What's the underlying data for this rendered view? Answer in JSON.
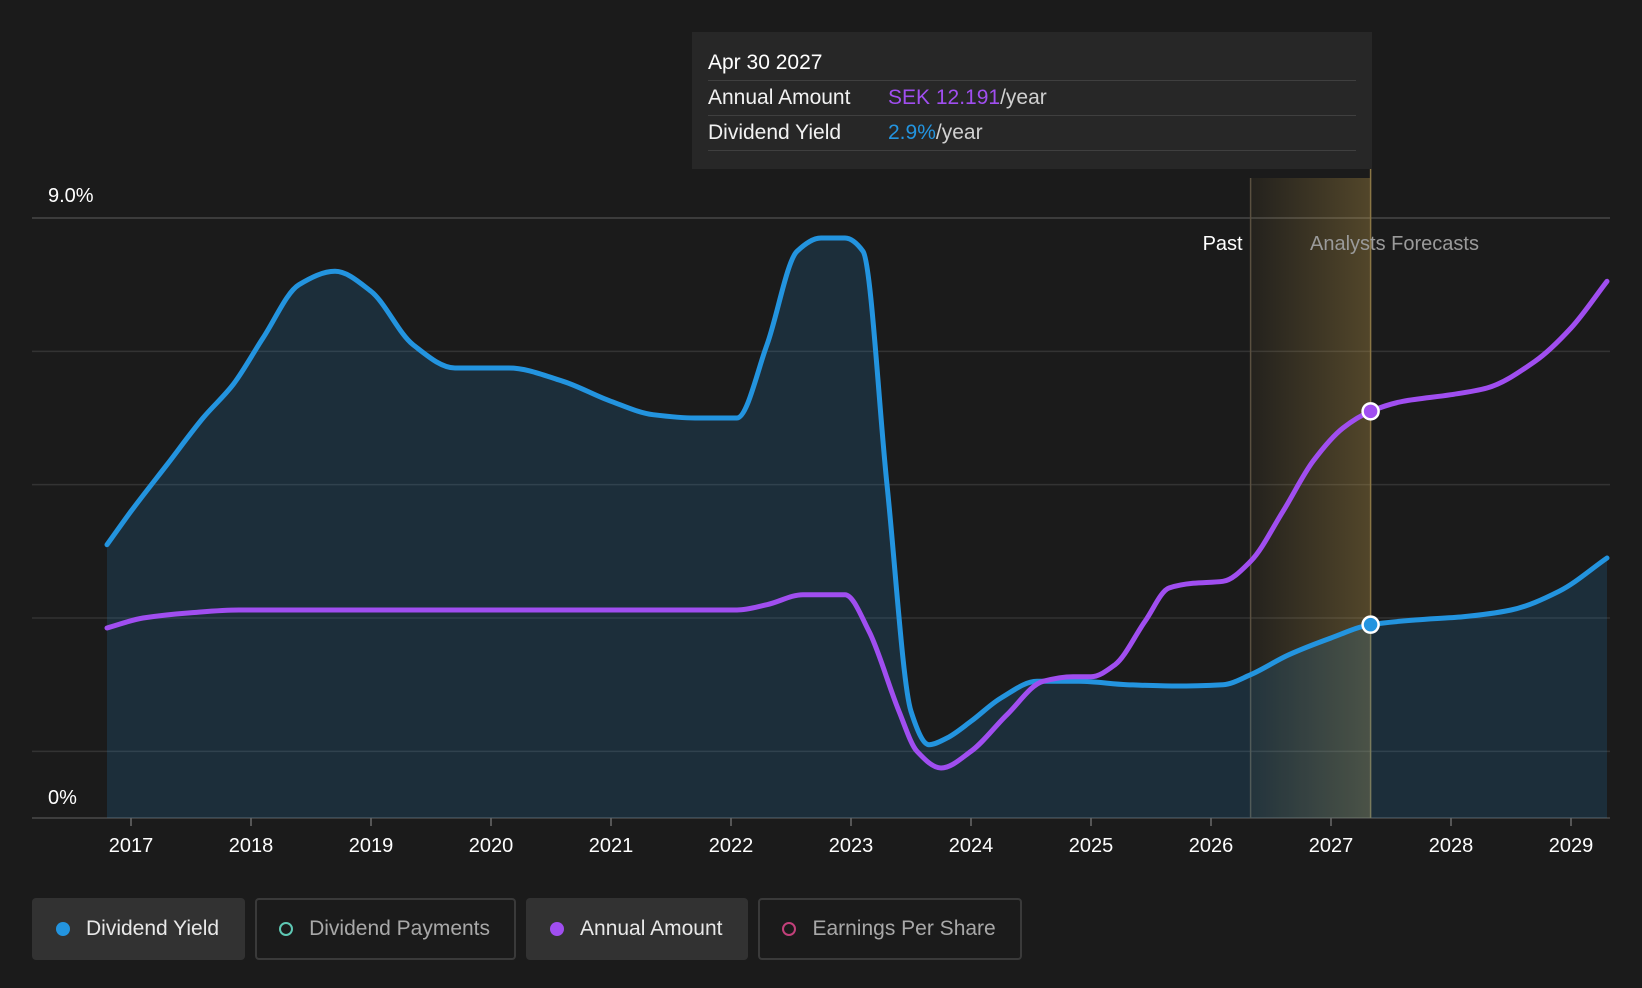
{
  "colors": {
    "background": "#1b1b1b",
    "dividend_yield": "#2394df",
    "annual_amount": "#a04ef0",
    "dividend_payments": "#5ec8b4",
    "earnings_per_share": "#c2407a",
    "forecast_band": "#c8a24a",
    "grid": "#3a3a3a"
  },
  "tooltip": {
    "date": "Apr 30 2027",
    "rows": [
      {
        "label": "Annual Amount",
        "value": "SEK 12.191",
        "unit": "/year",
        "color": "#a04ef0"
      },
      {
        "label": "Dividend Yield",
        "value": "2.9%",
        "unit": "/year",
        "color": "#2394df"
      }
    ]
  },
  "legend": [
    {
      "label": "Dividend Yield",
      "color": "#2394df",
      "active": true,
      "filled": true
    },
    {
      "label": "Dividend Payments",
      "color": "#5ec8b4",
      "active": false,
      "filled": false
    },
    {
      "label": "Annual Amount",
      "color": "#a04ef0",
      "active": true,
      "filled": true
    },
    {
      "label": "Earnings Per Share",
      "color": "#c2407a",
      "active": false,
      "filled": false
    }
  ],
  "chart_data": {
    "type": "area",
    "x_tick_labels": [
      "2017",
      "2018",
      "2019",
      "2020",
      "2021",
      "2022",
      "2023",
      "2024",
      "2025",
      "2026",
      "2027",
      "2028",
      "2029"
    ],
    "y_tick_labels": [
      "9.0%",
      "0%"
    ],
    "ylim": [
      0,
      9.0
    ],
    "xlim": [
      2016.8,
      2029.3
    ],
    "grid": true,
    "region_labels": {
      "past": "Past",
      "forecast": "Analysts Forecasts"
    },
    "forecast_band": [
      2026.33,
      2027.33
    ],
    "marker_x": 2027.33,
    "series": [
      {
        "name": "Dividend Yield",
        "x": [
          2016.8,
          2017.0,
          2017.3,
          2017.6,
          2017.85,
          2018.1,
          2018.4,
          2018.7,
          2019.0,
          2019.35,
          2019.7,
          2020.15,
          2020.6,
          2021.0,
          2021.35,
          2021.7,
          2022.05,
          2022.3,
          2022.55,
          2022.75,
          2022.95,
          2023.1,
          2023.3,
          2023.5,
          2023.65,
          2023.8,
          2024.0,
          2024.25,
          2024.55,
          2024.9,
          2025.3,
          2025.7,
          2026.1,
          2026.33,
          2026.65,
          2027.0,
          2027.33,
          2027.7,
          2028.1,
          2028.5,
          2028.9,
          2029.3
        ],
        "values": [
          4.1,
          4.6,
          5.3,
          6.0,
          6.5,
          7.2,
          8.0,
          8.2,
          7.9,
          7.1,
          6.75,
          6.75,
          6.55,
          6.25,
          6.05,
          6.0,
          6.0,
          7.1,
          8.5,
          8.7,
          8.7,
          8.5,
          5.0,
          1.6,
          1.1,
          1.2,
          1.45,
          1.8,
          2.05,
          2.05,
          2.0,
          1.98,
          2.0,
          2.15,
          2.45,
          2.7,
          2.9,
          2.97,
          3.02,
          3.12,
          3.4,
          3.9
        ],
        "color": "#2394df"
      },
      {
        "name": "Annual Amount",
        "x": [
          2016.8,
          2017.1,
          2017.5,
          2017.9,
          2018.5,
          2019.5,
          2020.5,
          2021.5,
          2022.05,
          2022.3,
          2022.6,
          2022.95,
          2023.15,
          2023.4,
          2023.55,
          2023.75,
          2024.0,
          2024.3,
          2024.6,
          2024.85,
          2025.0,
          2025.2,
          2025.45,
          2025.65,
          2025.85,
          2026.1,
          2026.33,
          2026.6,
          2026.85,
          2027.1,
          2027.33,
          2027.6,
          2028.0,
          2028.3,
          2028.7,
          2029.0,
          2029.3
        ],
        "values": [
          2.85,
          3.0,
          3.08,
          3.12,
          3.12,
          3.12,
          3.12,
          3.12,
          3.12,
          3.2,
          3.35,
          3.35,
          2.8,
          1.6,
          1.0,
          0.75,
          1.0,
          1.55,
          2.05,
          2.12,
          2.12,
          2.3,
          2.95,
          3.45,
          3.52,
          3.55,
          3.85,
          4.6,
          5.35,
          5.85,
          6.1,
          6.25,
          6.35,
          6.45,
          6.85,
          7.35,
          8.05
        ],
        "color": "#a04ef0"
      }
    ]
  }
}
